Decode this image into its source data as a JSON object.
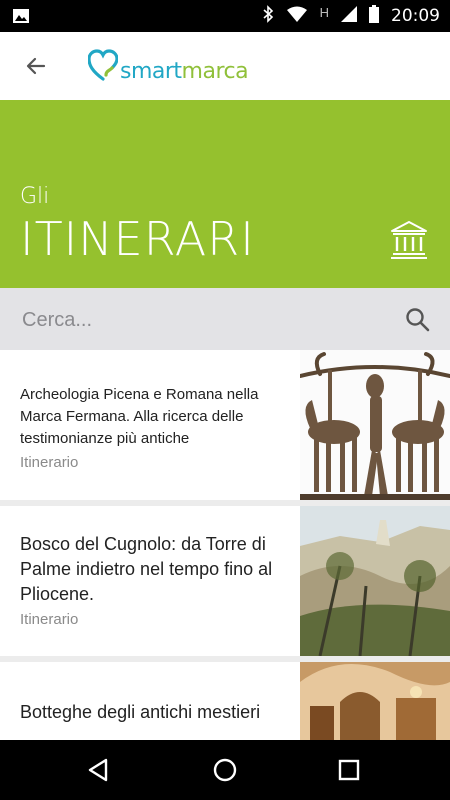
{
  "status_bar": {
    "time": "20:09",
    "network": "H"
  },
  "app_bar": {
    "logo_smart": "smart",
    "logo_marca": "marca"
  },
  "hero": {
    "pre_title": "Gli",
    "title": "ITINERARI"
  },
  "search": {
    "placeholder": "Cerca..."
  },
  "items": [
    {
      "title": "Archeologia Picena e Romana nella Marca Fermana. Alla ricerca delle testimonianze più antiche",
      "type": "Itinerario"
    },
    {
      "title": "Bosco del Cugnolo: da Torre di Palme indietro nel tempo fino al Pliocene.",
      "type": "Itinerario"
    },
    {
      "title": "Botteghe degli antichi mestieri",
      "type": ""
    }
  ],
  "colors": {
    "green": "#95c12e",
    "logo_blue": "#21a7c5",
    "logo_green": "#90c03a"
  }
}
